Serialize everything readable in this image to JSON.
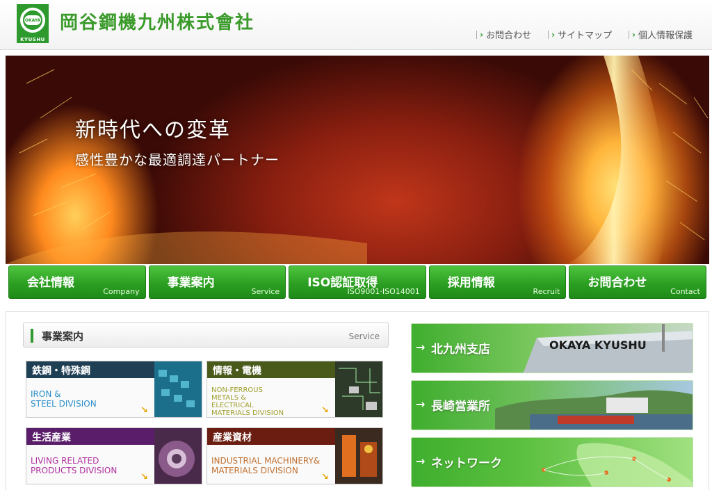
{
  "header": {
    "company_name": "岡谷鋼機九州株式會社",
    "logo_text": "KYUSHU",
    "logo_mark_text": "OKAYA",
    "util_links": [
      {
        "label": "お問合わせ"
      },
      {
        "label": "サイトマップ"
      },
      {
        "label": "個人情報保護"
      }
    ]
  },
  "hero": {
    "title": "新時代への変革",
    "subtitle": "感性豊かな最適調達パートナー"
  },
  "main_nav": [
    {
      "ja": "会社情報",
      "en": "Company"
    },
    {
      "ja": "事業案内",
      "en": "Service"
    },
    {
      "ja": "ISO認証取得",
      "en": "ISO9001·ISO14001"
    },
    {
      "ja": "採用情報",
      "en": "Recruit"
    },
    {
      "ja": "お問合わせ",
      "en": "Contact"
    }
  ],
  "service_section": {
    "title": "事業案内",
    "title_en": "Service"
  },
  "divisions": [
    {
      "ja": "鉄鋼・特殊鋼",
      "en": "IRON &\nSTEEL DIVISION",
      "color": "#1f3f54",
      "en_color": "#2a8ec8"
    },
    {
      "ja": "情報・電機",
      "en": "NON-FERROUS\nMETALS &\nELECTRICAL\nMATERIALS DIVISION",
      "color": "#4a5a1a",
      "en_color": "#a0a030"
    },
    {
      "ja": "生活産業",
      "en": "LIVING RELATED\nPRODUCTS DIVISION",
      "color": "#5a1d6a",
      "en_color": "#b030a0"
    },
    {
      "ja": "産業資材",
      "en": "INDUSTRIAL MACHINERY&\nMATERIALS DIVISION",
      "color": "#6a1d10",
      "en_color": "#c07030"
    }
  ],
  "branches": [
    {
      "label": "北九州支店"
    },
    {
      "label": "長崎営業所"
    },
    {
      "label": "ネットワーク"
    }
  ],
  "colors": {
    "brand_green": "#2e9a2e",
    "arrow_yellow": "#e8a400"
  },
  "icons": {
    "nav_arrow": "→",
    "util_arrow": "＞",
    "div_arrow": "↘"
  }
}
